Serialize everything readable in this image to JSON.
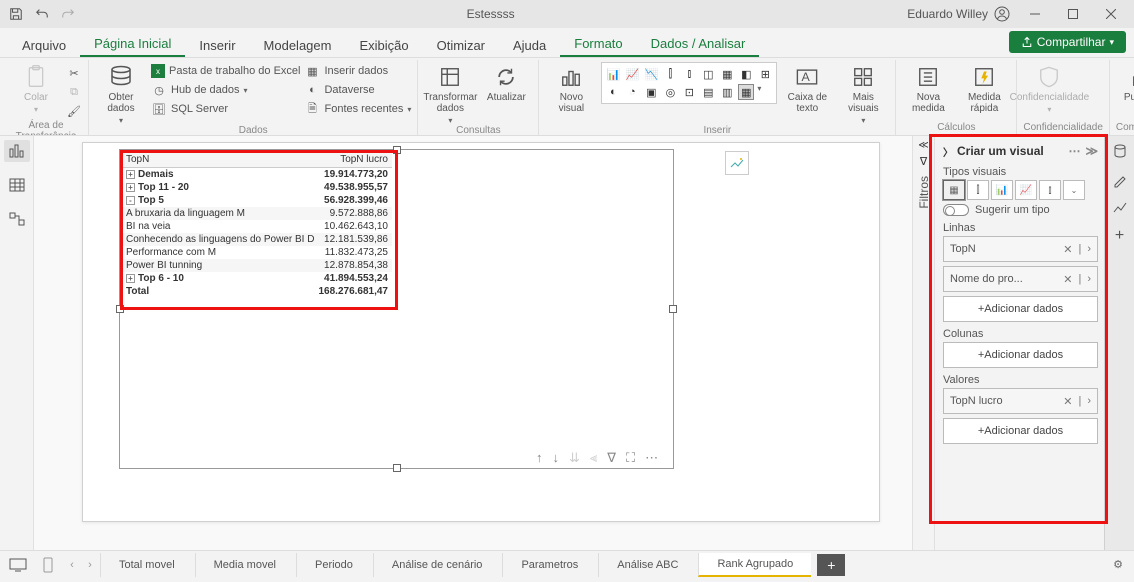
{
  "titlebar": {
    "title": "Estessss",
    "user": "Eduardo Willey"
  },
  "tabs": {
    "arquivo": "Arquivo",
    "pagina": "Página Inicial",
    "inserir": "Inserir",
    "modelagem": "Modelagem",
    "exibicao": "Exibição",
    "otimizar": "Otimizar",
    "ajuda": "Ajuda",
    "formato": "Formato",
    "dados": "Dados / Analisar",
    "compartilhar": "Compartilhar"
  },
  "ribbon": {
    "g1": {
      "label": "Área de Transferência",
      "colar": "Colar"
    },
    "g2": {
      "label": "Dados",
      "obter": "Obter\ndados",
      "excel": "Pasta de trabalho do Excel",
      "hub": "Hub de dados",
      "sql": "SQL Server",
      "inserir": "Inserir dados",
      "dataverse": "Dataverse",
      "fontes": "Fontes recentes"
    },
    "g3": {
      "label": "Consultas",
      "transformar": "Transformar\ndados",
      "atualizar": "Atualizar"
    },
    "g4": {
      "label": "Inserir",
      "novo": "Novo\nvisual",
      "caixa": "Caixa de\ntexto",
      "mais": "Mais\nvisuais"
    },
    "g5": {
      "label": "Cálculos",
      "nova": "Nova\nmedida",
      "rapida": "Medida\nrápida"
    },
    "g6": {
      "label": "Confidencialidade",
      "conf": "Confidencialidade"
    },
    "g7": {
      "label": "Compartilhar",
      "pub": "Publicar"
    }
  },
  "matrix": {
    "h1": "TopN",
    "h2": "TopN lucro",
    "rows": [
      {
        "exp": "+",
        "l": "Demais",
        "v": "19.914.773,20",
        "b": true
      },
      {
        "exp": "+",
        "l": "Top 11 - 20",
        "v": "49.538.955,57",
        "b": true
      },
      {
        "exp": "-",
        "l": "Top 5",
        "v": "56.928.399,46",
        "b": true
      },
      {
        "ind": true,
        "l": "A bruxaria da linguagem M",
        "v": "9.572.888,86"
      },
      {
        "ind": true,
        "l": "BI na veia",
        "v": "10.462.643,10"
      },
      {
        "ind": true,
        "l": "Conhecendo as linguagens do Power BI Desktop",
        "v": "12.181.539,86"
      },
      {
        "ind": true,
        "l": "Performance com M",
        "v": "11.832.473,25"
      },
      {
        "ind": true,
        "l": "Power BI tunning",
        "v": "12.878.854,38"
      },
      {
        "exp": "+",
        "l": "Top 6 - 10",
        "v": "41.894.553,24",
        "b": true
      },
      {
        "l": "Total",
        "v": "168.276.681,47",
        "b": true
      }
    ]
  },
  "viz": {
    "title": "Criar um visual",
    "tipos": "Tipos visuais",
    "sugerir": "Sugerir um tipo",
    "linhas": "Linhas",
    "f_topn": "TopN",
    "f_nome": "Nome do pro...",
    "add": "+Adicionar dados",
    "colunas": "Colunas",
    "valores": "Valores",
    "f_lucro": "TopN lucro"
  },
  "filtros": "Filtros",
  "pages": {
    "p1": "Total movel",
    "p2": "Media movel",
    "p3": "Periodo",
    "p4": "Análise de cenário",
    "p5": "Parametros",
    "p6": "Análise ABC",
    "p7": "Rank Agrupado"
  }
}
